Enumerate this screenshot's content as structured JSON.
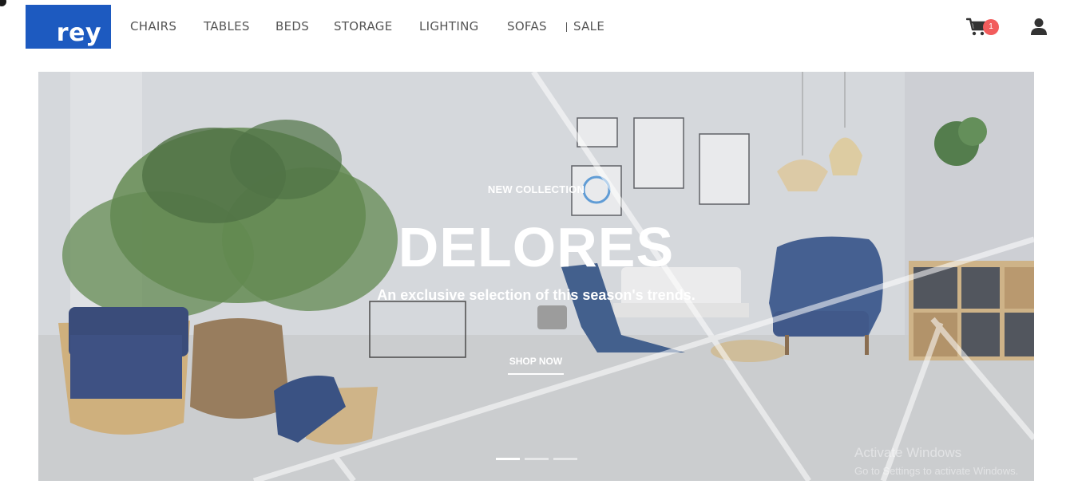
{
  "brand": {
    "logo_text": "rey",
    "color": "#1d5ac0"
  },
  "nav": {
    "items": [
      {
        "label": "CHAIRS"
      },
      {
        "label": "TABLES"
      },
      {
        "label": "BEDS"
      },
      {
        "label": "STORAGE"
      },
      {
        "label": "LIGHTING"
      },
      {
        "label": "SOFAS"
      },
      {
        "label": "SALE"
      }
    ]
  },
  "header": {
    "cart_icon": "shopping-cart-icon",
    "cart_count": "1",
    "badge_color": "#f25c5c",
    "user_icon": "user-icon"
  },
  "hero": {
    "eyebrow": "NEW COLLECTION",
    "title": "DELORES",
    "subtitle": "An exclusive selection of this season's trends.",
    "cta": "SHOP NOW",
    "slides_count": 3,
    "active_slide": 1
  },
  "watermark": {
    "title": "Activate Windows",
    "subtitle": "Go to Settings to activate Windows."
  }
}
